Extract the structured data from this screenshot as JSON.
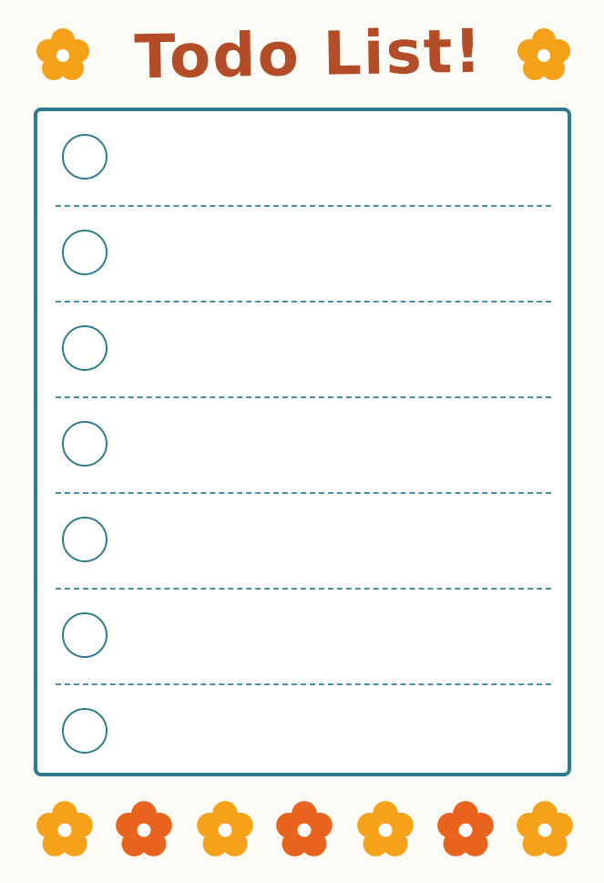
{
  "header": {
    "title": "Todo List!"
  },
  "todo_list": {
    "item_count": 7,
    "items": [
      {
        "checked": false,
        "text": ""
      },
      {
        "checked": false,
        "text": ""
      },
      {
        "checked": false,
        "text": ""
      },
      {
        "checked": false,
        "text": ""
      },
      {
        "checked": false,
        "text": ""
      },
      {
        "checked": false,
        "text": ""
      },
      {
        "checked": false,
        "text": ""
      }
    ]
  },
  "decorations": {
    "header_flowers": [
      "flower-icon",
      "flower-icon"
    ],
    "footer_flowers": [
      "flower-icon",
      "flower-icon",
      "flower-icon",
      "flower-icon",
      "flower-icon",
      "flower-icon",
      "flower-icon"
    ]
  },
  "colors": {
    "title": "#b24d27",
    "border": "#2f7b8c",
    "flower_yellow": "#f5a21a",
    "flower_orange": "#e8641e",
    "flower_center": "#ffffff"
  }
}
